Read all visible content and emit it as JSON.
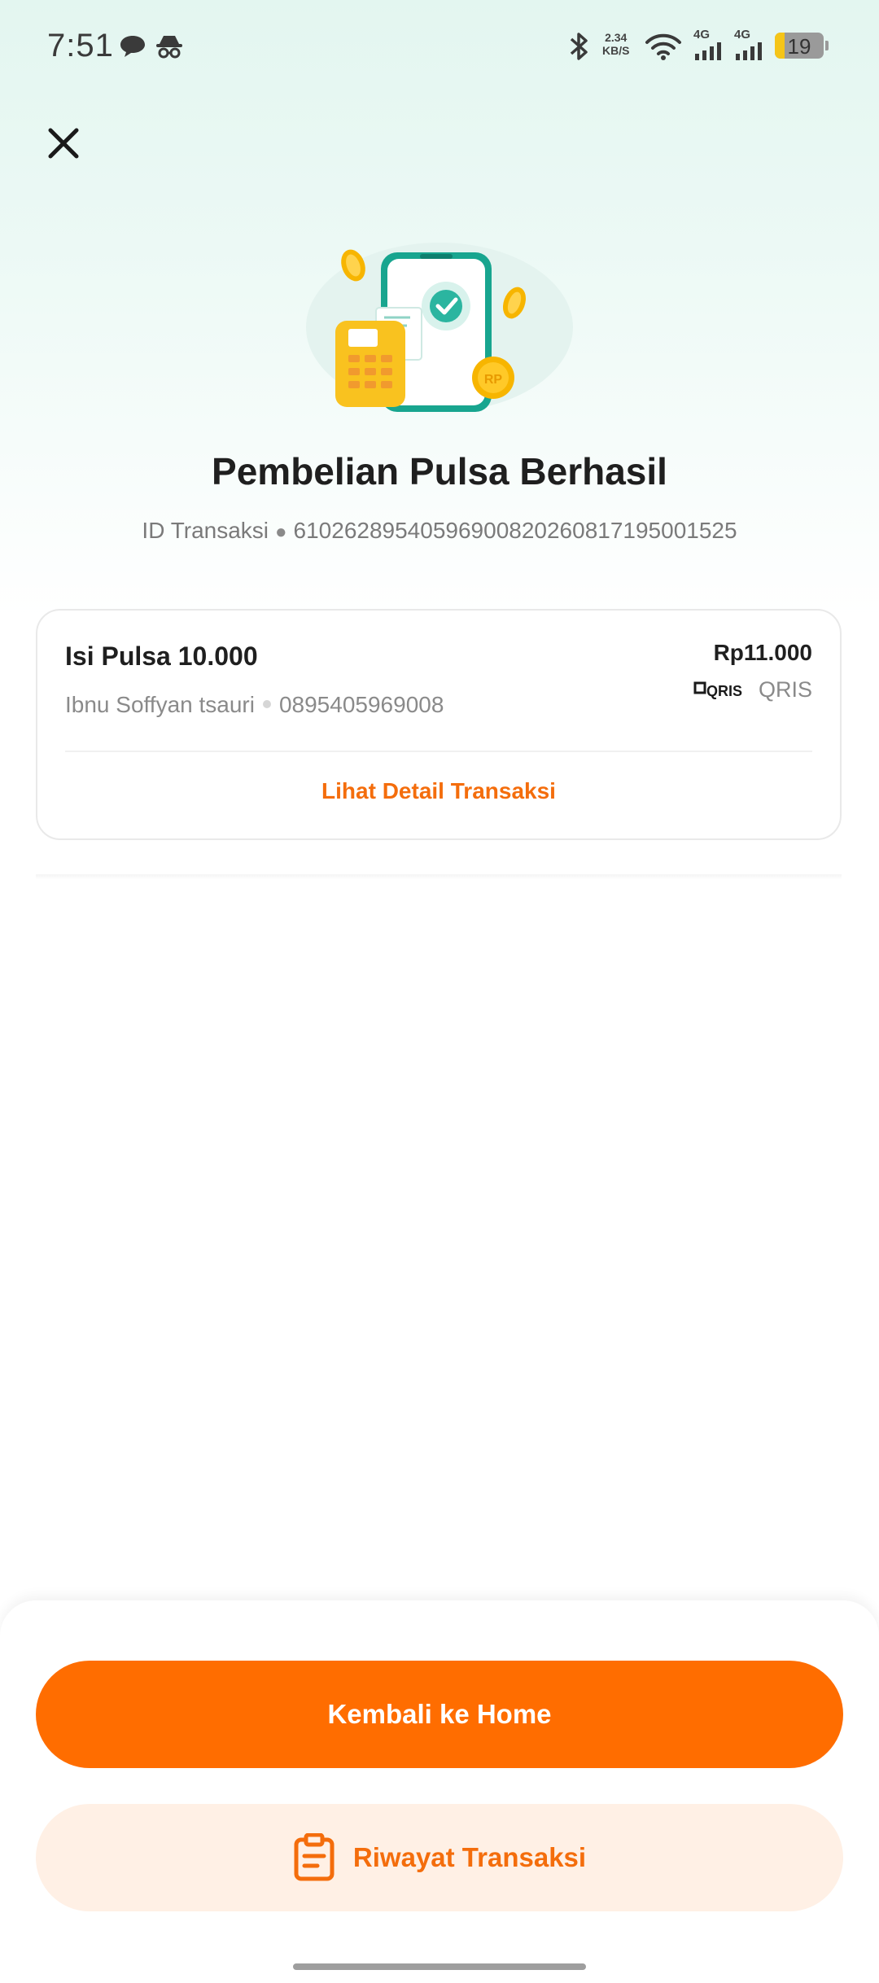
{
  "status_bar": {
    "time": "7:51",
    "net_speed_value": "2.34",
    "net_speed_unit": "KB/S",
    "network_1": "4G",
    "network_2": "4G",
    "battery": "19",
    "icons": [
      "chat-bubble-icon",
      "incognito-icon",
      "bluetooth-icon",
      "wifi-icon",
      "signal-icon",
      "signal-icon",
      "battery-icon"
    ]
  },
  "header": {
    "close_icon": "close-icon"
  },
  "result": {
    "title": "Pembelian Pulsa Berhasil",
    "transaction_label": "ID Transaksi",
    "transaction_sep": "●",
    "transaction_id": "610262895405969008202608171950015 25"
  },
  "card": {
    "product": "Isi Pulsa 10.000",
    "buyer_name": "Ibnu Soffyan tsauri",
    "phone": "0895405969008",
    "price": "Rp11.000",
    "payment_logo_text": "QRIS",
    "payment_method": "QRIS",
    "detail_link": "Lihat Detail Transaksi"
  },
  "actions": {
    "home_label": "Kembali ke Home",
    "history_label": "Riwayat Transaksi"
  },
  "colors": {
    "accent": "#ff6d00",
    "accent_soft": "#fff0e5",
    "success": "#2bb5a0"
  }
}
